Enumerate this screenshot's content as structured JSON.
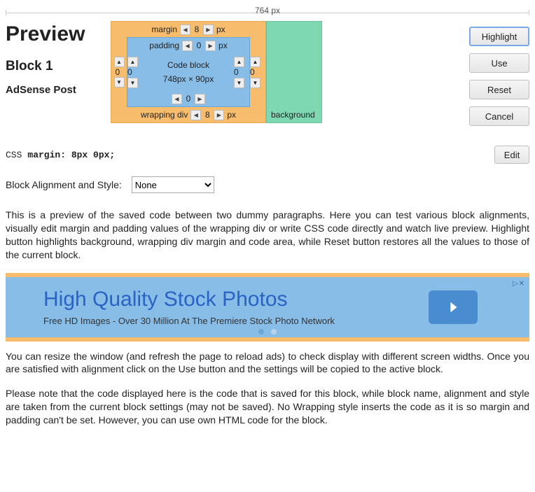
{
  "ruler": {
    "label": "764 px"
  },
  "left": {
    "preview": "Preview",
    "block": "Block 1",
    "subtitle": "AdSense Post"
  },
  "box": {
    "margin_label": "margin",
    "padding_label": "padding",
    "wrapping_label": "wrapping div",
    "background_label": "background",
    "px": "px",
    "margin_top": "8",
    "margin_right": "0",
    "margin_bottom": "8",
    "margin_left": "0",
    "padding_top": "0",
    "padding_right": "0",
    "padding_bottom": "0",
    "padding_left": "0",
    "inner_title": "Code block",
    "inner_dim": "748px × 90px"
  },
  "buttons": {
    "highlight": "Highlight",
    "use": "Use",
    "reset": "Reset",
    "cancel": "Cancel",
    "edit": "Edit"
  },
  "css": {
    "label": "CSS",
    "value": "margin: 8px 0px;"
  },
  "align": {
    "label": "Block Alignment and Style:",
    "selected": "None"
  },
  "paragraphs": {
    "p1": "This is a preview of the saved code between two dummy paragraphs. Here you can test various block alignments, visually edit margin and padding values of the wrapping div or write CSS code directly and watch live preview. Highlight button highlights background, wrapping div margin and code area, while Reset button restores all the values to those of the current block.",
    "p2": "You can resize the window (and refresh the page to reload ads) to check display with different screen widths. Once you are satisfied with alignment click on the Use button and the settings will be copied to the active block.",
    "p3": "Please note that the code displayed here is the code that is saved for this block, while block name, alignment and style are taken from the current block settings (may not be saved). No Wrapping style inserts the code as it is so margin and padding can't be set. However, you can use own HTML code for the block."
  },
  "ad": {
    "title": "High Quality Stock Photos",
    "subtitle": "Free HD Images - Over 30 Million At The Premiere Stock Photo Network",
    "close": "▷✕"
  }
}
